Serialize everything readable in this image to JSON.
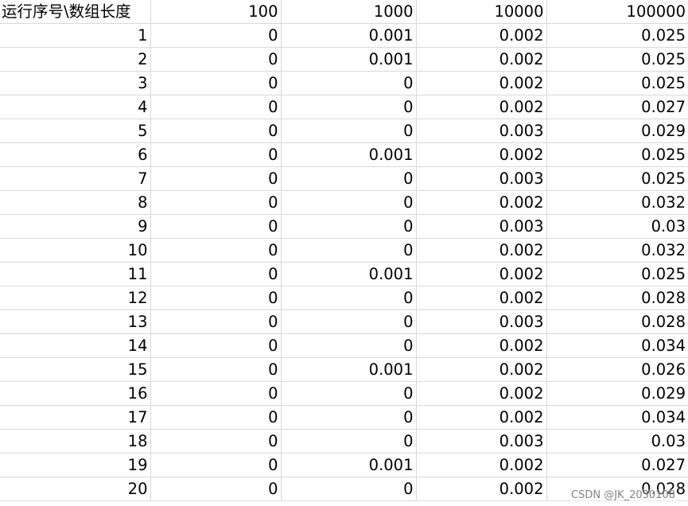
{
  "sheet": {
    "corner_label": "运行序号\\数组长度",
    "columns": [
      "100",
      "1000",
      "10000",
      "100000"
    ],
    "rows": [
      {
        "run": "1",
        "values": [
          "0",
          "0.001",
          "0.002",
          "0.025"
        ]
      },
      {
        "run": "2",
        "values": [
          "0",
          "0.001",
          "0.002",
          "0.025"
        ]
      },
      {
        "run": "3",
        "values": [
          "0",
          "0",
          "0.002",
          "0.025"
        ]
      },
      {
        "run": "4",
        "values": [
          "0",
          "0",
          "0.002",
          "0.027"
        ]
      },
      {
        "run": "5",
        "values": [
          "0",
          "0",
          "0.003",
          "0.029"
        ]
      },
      {
        "run": "6",
        "values": [
          "0",
          "0.001",
          "0.002",
          "0.025"
        ]
      },
      {
        "run": "7",
        "values": [
          "0",
          "0",
          "0.003",
          "0.025"
        ]
      },
      {
        "run": "8",
        "values": [
          "0",
          "0",
          "0.002",
          "0.032"
        ]
      },
      {
        "run": "9",
        "values": [
          "0",
          "0",
          "0.003",
          "0.03"
        ]
      },
      {
        "run": "10",
        "values": [
          "0",
          "0",
          "0.002",
          "0.032"
        ]
      },
      {
        "run": "11",
        "values": [
          "0",
          "0.001",
          "0.002",
          "0.025"
        ]
      },
      {
        "run": "12",
        "values": [
          "0",
          "0",
          "0.002",
          "0.028"
        ]
      },
      {
        "run": "13",
        "values": [
          "0",
          "0",
          "0.003",
          "0.028"
        ]
      },
      {
        "run": "14",
        "values": [
          "0",
          "0",
          "0.002",
          "0.034"
        ]
      },
      {
        "run": "15",
        "values": [
          "0",
          "0.001",
          "0.002",
          "0.026"
        ]
      },
      {
        "run": "16",
        "values": [
          "0",
          "0",
          "0.002",
          "0.029"
        ]
      },
      {
        "run": "17",
        "values": [
          "0",
          "0",
          "0.002",
          "0.034"
        ]
      },
      {
        "run": "18",
        "values": [
          "0",
          "0",
          "0.003",
          "0.03"
        ]
      },
      {
        "run": "19",
        "values": [
          "0",
          "0.001",
          "0.002",
          "0.027"
        ]
      },
      {
        "run": "20",
        "values": [
          "0",
          "0",
          "0.002",
          "0.028"
        ]
      }
    ]
  },
  "watermark": "CSDN @JK_2030108",
  "colors": {
    "gridline": "#d9d9d9",
    "text": "#000000",
    "background": "#ffffff"
  }
}
